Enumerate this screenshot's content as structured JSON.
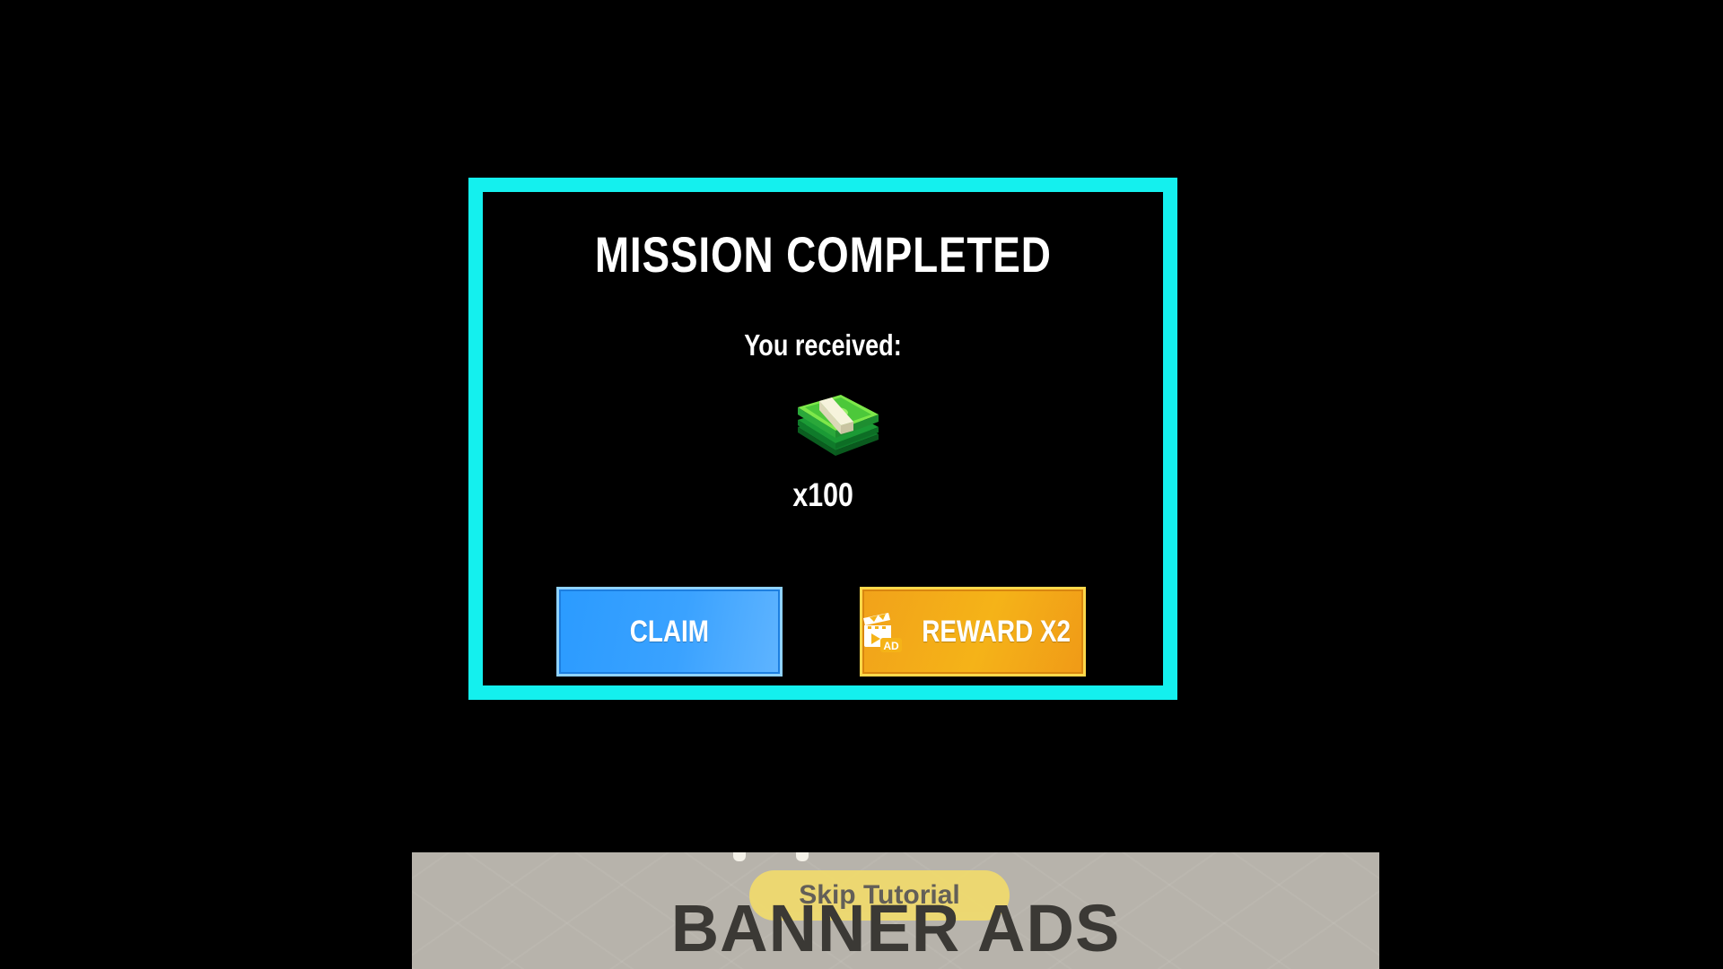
{
  "dialog": {
    "title": "MISSION COMPLETED",
    "received_label": "You received:",
    "reward": {
      "icon": "cash-stack-icon",
      "amount": "x100"
    },
    "buttons": {
      "claim_label": "CLAIM",
      "reward_label": "REWARD X2",
      "reward_icon": "video-ad-icon"
    },
    "border_color": "#14f0ee"
  },
  "banner": {
    "skip_label": "Skip Tutorial",
    "ad_label": "BANNER ADS"
  },
  "colors": {
    "background": "#000000",
    "claim_button": "#2b9bff",
    "reward_button": "#f5b318",
    "text": "#ffffff"
  }
}
